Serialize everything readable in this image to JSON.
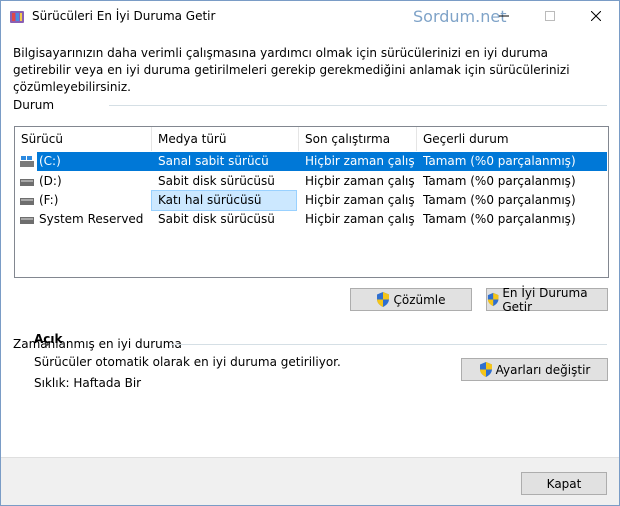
{
  "window": {
    "title": "Sürücüleri En İyi Duruma Getir",
    "watermark": "Sordum.net"
  },
  "description": "Bilgisayarınızın daha verimli çalışmasına yardımcı olmak için sürücülerinizi en iyi duruma getirebilir veya en iyi duruma getirilmeleri gerekip gerekmediğini anlamak için sürücülerinizi çözümleyebilirsiniz.",
  "status_section": {
    "label": "Durum"
  },
  "table": {
    "columns": [
      "Sürücü",
      "Medya türü",
      "Son çalıştırma",
      "Geçerli durum"
    ],
    "rows": [
      {
        "drive": "(C:)",
        "media": "Sanal sabit sürücü",
        "last_run": "Hiçbir zaman çalış...",
        "status": "Tamam (%0 parçalanmış)",
        "icon": "system-drive-icon"
      },
      {
        "drive": "(D:)",
        "media": "Sabit disk sürücüsü",
        "last_run": "Hiçbir zaman çalış...",
        "status": "Tamam (%0 parçalanmış)",
        "icon": "hard-drive-icon"
      },
      {
        "drive": "(F:)",
        "media": "Katı hal sürücüsü",
        "last_run": "Hiçbir zaman çalış...",
        "status": "Tamam (%0 parçalanmış)",
        "icon": "hard-drive-icon"
      },
      {
        "drive": "System Reserved",
        "media": "Sabit disk sürücüsü",
        "last_run": "Hiçbir zaman çalış...",
        "status": "Tamam (%0 parçalanmış)",
        "icon": "hard-drive-icon"
      }
    ]
  },
  "buttons": {
    "analyze": "Çözümle",
    "optimize": "En İyi Duruma Getir",
    "change_settings": "Ayarları değiştir",
    "close": "Kapat"
  },
  "scheduled": {
    "label": "Zamanlanmış en iyi duruma",
    "state": "Açık",
    "info": "Sürücüler otomatik olarak en iyi duruma getiriliyor.",
    "frequency": "Sıklık: Haftada Bir"
  },
  "colors": {
    "selection": "#0078d7",
    "cell_highlight": "#cce8ff",
    "watermark": "#7fa3c8"
  }
}
